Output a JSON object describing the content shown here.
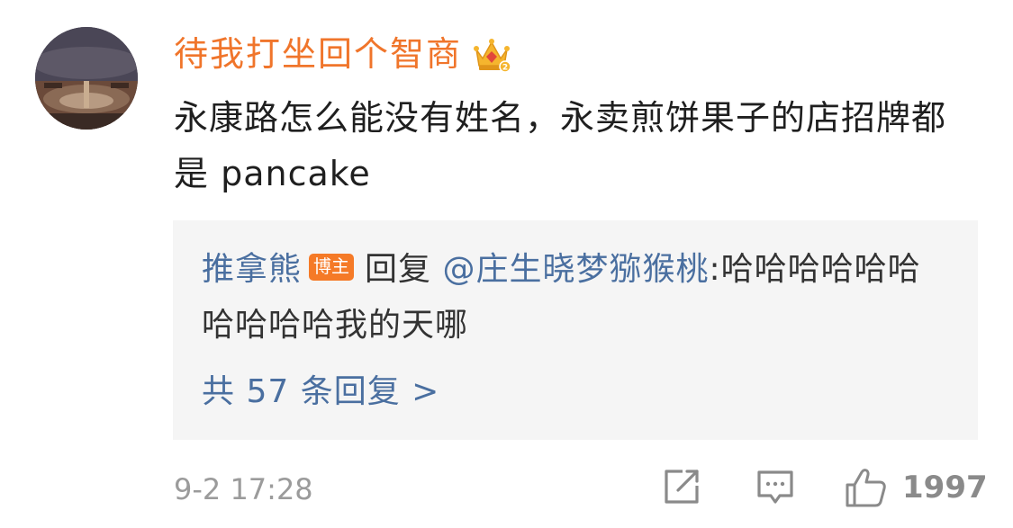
{
  "comment": {
    "username": "待我打坐回个智商",
    "badge_icon": "crown-vip-icon",
    "text": "永康路怎么能没有姓名，永卖煎饼果子的店招牌都是 pancake",
    "reply": {
      "author": "推拿熊",
      "author_badge": "博主",
      "action": "回复",
      "mention": "@庄生晓梦猕猴桃",
      "separator": ":",
      "content": "哈哈哈哈哈哈哈哈哈哈我的天哪",
      "more_link": "共 57 条回复 >"
    },
    "timestamp": "9-2 17:28",
    "actions": {
      "share_icon": "share-icon",
      "comment_icon": "comment-icon",
      "like_icon": "thumbs-up-icon",
      "like_count": "1997"
    }
  },
  "colors": {
    "username": "#f0752b",
    "link_blue": "#4a6fa0",
    "badge_orange": "#f57a27",
    "reply_bg": "#f5f5f5",
    "meta_gray": "#9b9b9b"
  }
}
